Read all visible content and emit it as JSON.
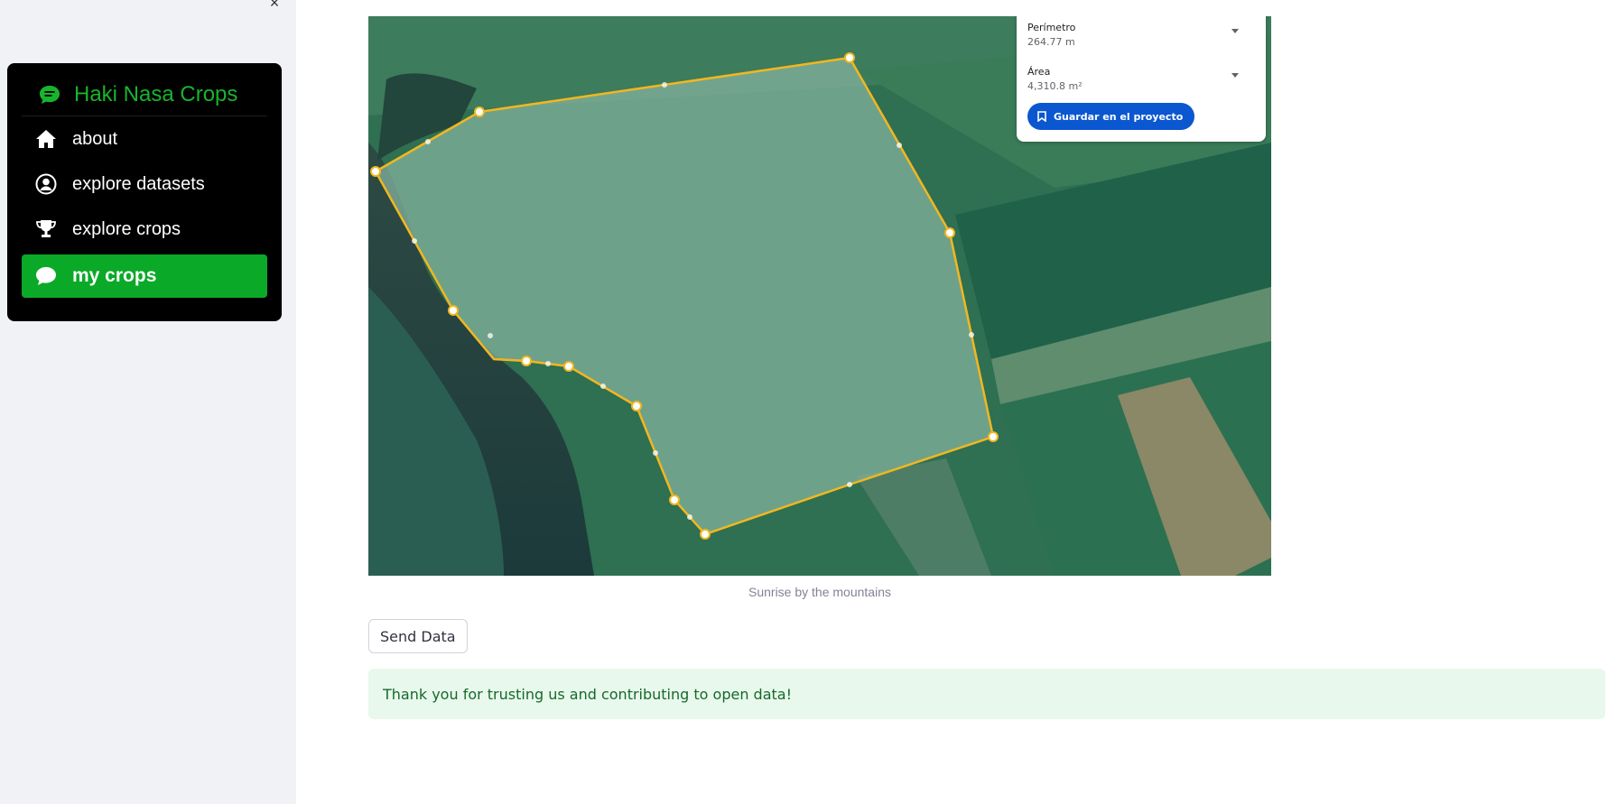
{
  "sidebar": {
    "close_icon": "×",
    "app_title": "Haki Nasa Crops",
    "items": [
      {
        "label": "about",
        "icon": "house-icon"
      },
      {
        "label": "explore datasets",
        "icon": "person-circle-icon"
      },
      {
        "label": "explore crops",
        "icon": "trophy-icon"
      },
      {
        "label": "my crops",
        "icon": "chat-icon",
        "active": true
      }
    ],
    "accent_color": "#0ba928"
  },
  "map_panel": {
    "perimeter_label": "Perímetro",
    "perimeter_value": "264.77 m",
    "area_label": "Área",
    "area_value": "4,310.8 m²",
    "save_label": "Guardar en el proyecto"
  },
  "main": {
    "caption": "Sunrise by the mountains",
    "send_label": "Send Data",
    "success_message": "Thank you for trusting us and contributing to open data!"
  }
}
